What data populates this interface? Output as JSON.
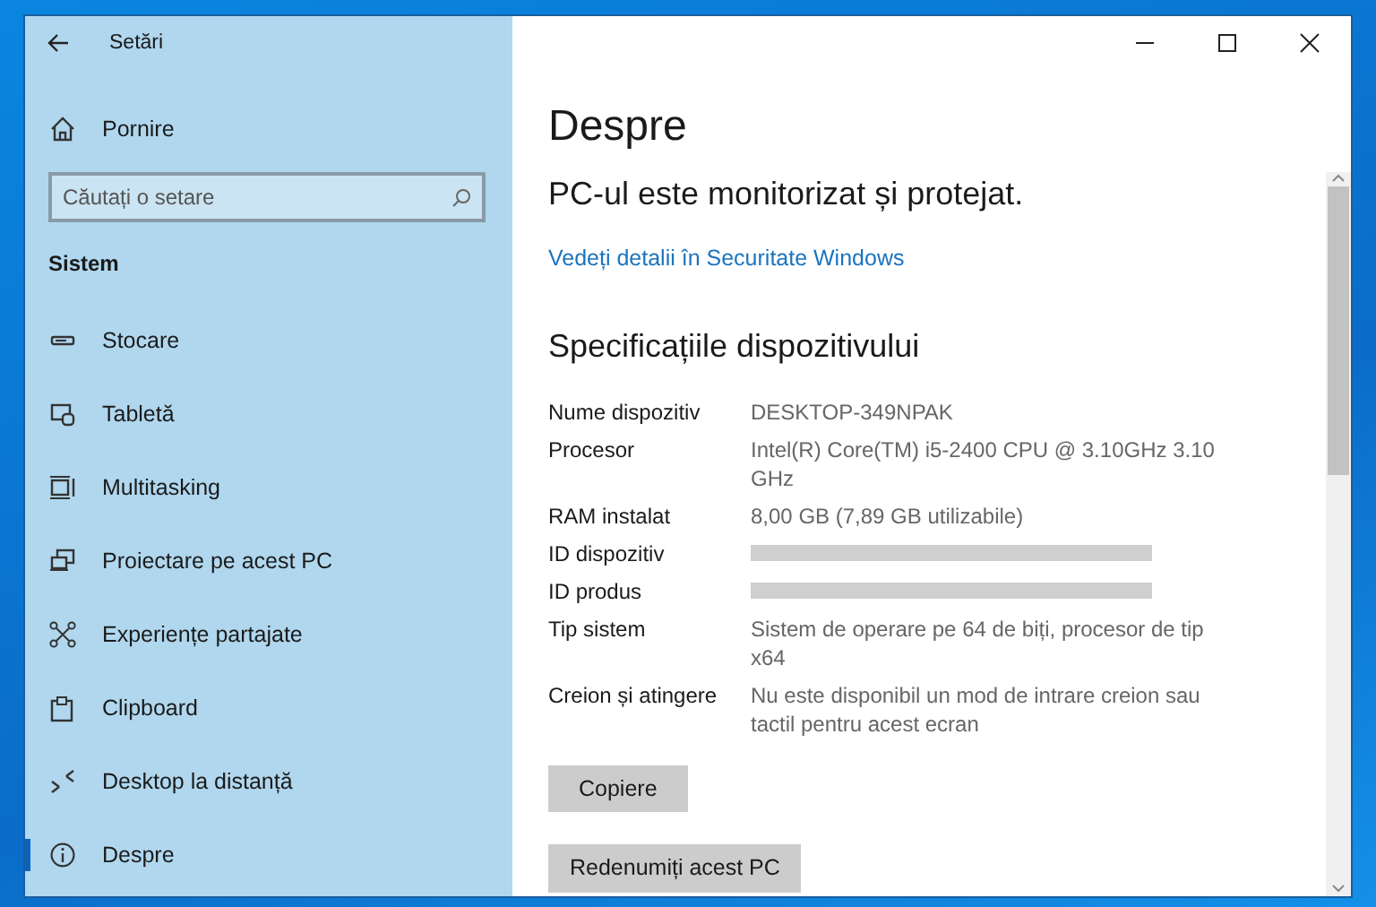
{
  "window": {
    "title": "Setări"
  },
  "sidebar": {
    "home": {
      "label": "Pornire"
    },
    "search": {
      "placeholder": "Căutați o setare"
    },
    "section": "Sistem",
    "items": [
      {
        "label": "Stocare",
        "selected": false
      },
      {
        "label": "Tabletă",
        "selected": false
      },
      {
        "label": "Multitasking",
        "selected": false
      },
      {
        "label": "Proiectare pe acest PC",
        "selected": false
      },
      {
        "label": "Experiențe partajate",
        "selected": false
      },
      {
        "label": "Clipboard",
        "selected": false
      },
      {
        "label": "Desktop la distanță",
        "selected": false
      },
      {
        "label": "Despre",
        "selected": true
      }
    ]
  },
  "content": {
    "title": "Despre",
    "status": "PC-ul este monitorizat și protejat.",
    "link": "Vedeți detalii în Securitate Windows",
    "section": "Specificațiile dispozitivului",
    "specs": [
      {
        "label": "Nume dispozitiv",
        "kind": "text",
        "value": "DESKTOP-349NPAK"
      },
      {
        "label": "Procesor",
        "kind": "text",
        "value": "Intel(R) Core(TM) i5-2400 CPU @ 3.10GHz   3.10 GHz"
      },
      {
        "label": "RAM instalat",
        "kind": "text",
        "value": "8,00 GB (7,89 GB utilizabile)"
      },
      {
        "label": "ID dispozitiv",
        "kind": "redacted"
      },
      {
        "label": "ID produs",
        "kind": "redacted"
      },
      {
        "label": "Tip sistem",
        "kind": "text",
        "value": "Sistem de operare pe 64 de biți, procesor de tip x64"
      },
      {
        "label": "Creion și atingere",
        "kind": "text",
        "value": "Nu este disponibil un mod de intrare creion sau tactil pentru acest ecran"
      }
    ],
    "buttons": [
      "Copiere",
      "Redenumiți acest PC"
    ]
  }
}
